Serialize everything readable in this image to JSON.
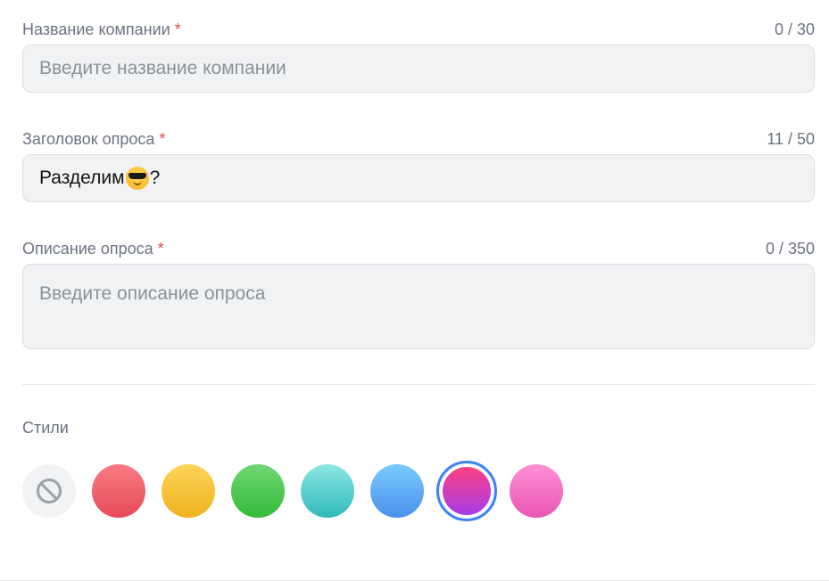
{
  "company": {
    "label": "Название компании",
    "required_mark": "*",
    "counter": "0 / 30",
    "placeholder": "Введите название компании",
    "value": ""
  },
  "title": {
    "label": "Заголовок опроса",
    "required_mark": "*",
    "counter": "11 / 50",
    "value_before_emoji": "Разделим",
    "emoji": "sunglasses-emoji",
    "value_after_emoji": "?"
  },
  "description": {
    "label": "Описание опроса",
    "required_mark": "*",
    "counter": "0 / 350",
    "placeholder": "Введите описание опроса",
    "value": ""
  },
  "styles": {
    "label": "Стили",
    "selected_index": 6,
    "swatches": [
      {
        "name": "none",
        "icon": "no-style-icon"
      },
      {
        "name": "red",
        "colors": [
          "#f87a84",
          "#e84a5a"
        ]
      },
      {
        "name": "yellow",
        "colors": [
          "#fcd458",
          "#efb31f"
        ]
      },
      {
        "name": "green",
        "colors": [
          "#6fd772",
          "#35bb3a"
        ]
      },
      {
        "name": "teal",
        "colors": [
          "#8ce6e3",
          "#2fbab8"
        ]
      },
      {
        "name": "blue",
        "colors": [
          "#79caff",
          "#4a91ea"
        ]
      },
      {
        "name": "pink-purple",
        "colors": [
          "#ff3f7c",
          "#a23cf0"
        ]
      },
      {
        "name": "pink",
        "colors": [
          "#ff8fd4",
          "#e956b4"
        ]
      }
    ],
    "selected_ring_color": "#3b82f6"
  }
}
